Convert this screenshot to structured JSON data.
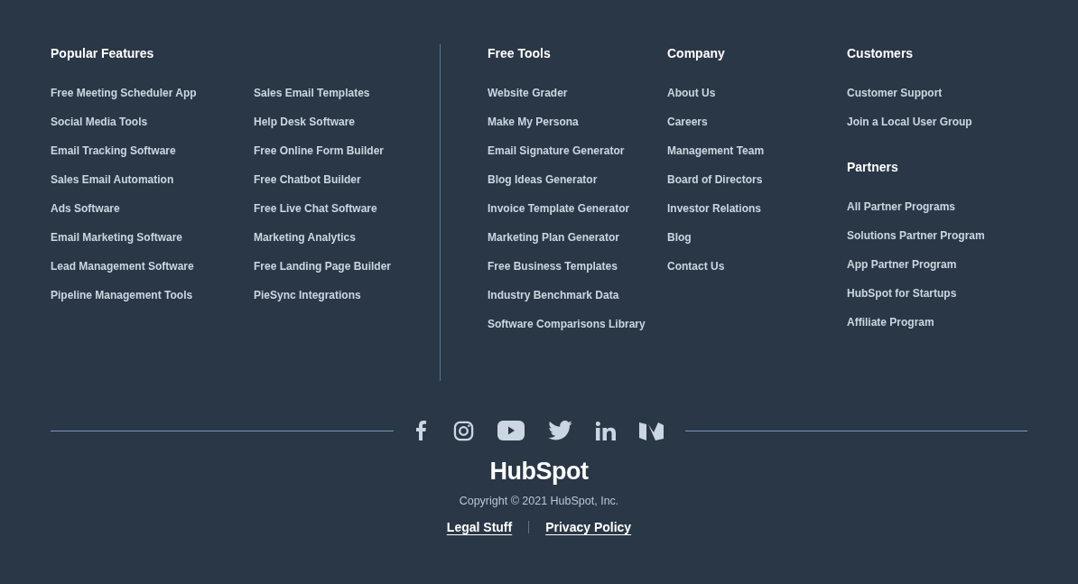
{
  "popular_features": {
    "heading": "Popular Features",
    "column_1": [
      "Free Meeting Scheduler App",
      "Social Media Tools",
      "Email Tracking Software",
      "Sales Email Automation",
      "Ads Software",
      "Email Marketing Software",
      "Lead Management Software",
      "Pipeline Management Tools"
    ],
    "column_2": [
      "Sales Email Templates",
      "Help Desk Software",
      "Free Online Form Builder",
      "Free Chatbot Builder",
      "Free Live Chat Software",
      "Marketing Analytics",
      "Free Landing Page Builder",
      "PieSync Integrations"
    ]
  },
  "free_tools": {
    "heading": "Free Tools",
    "links": [
      "Website Grader",
      "Make My Persona",
      "Email Signature Generator",
      "Blog Ideas Generator",
      "Invoice Template Generator",
      "Marketing Plan Generator",
      "Free Business Templates",
      "Industry Benchmark Data",
      "Software Comparisons Library"
    ]
  },
  "company": {
    "heading": "Company",
    "links": [
      "About Us",
      "Careers",
      "Management Team",
      "Board of Directors",
      "Investor Relations",
      "Blog",
      "Contact Us"
    ]
  },
  "customers": {
    "heading": "Customers",
    "links": [
      "Customer Support",
      "Join a Local User Group"
    ]
  },
  "partners": {
    "heading": "Partners",
    "links": [
      "All Partner Programs",
      "Solutions Partner Program",
      "App Partner Program",
      "HubSpot for Startups",
      "Affiliate Program"
    ]
  },
  "logo": "HubSpot",
  "copyright": "Copyright © 2021 HubSpot, Inc.",
  "legal_links": [
    "Legal Stuff",
    "Privacy Policy"
  ]
}
